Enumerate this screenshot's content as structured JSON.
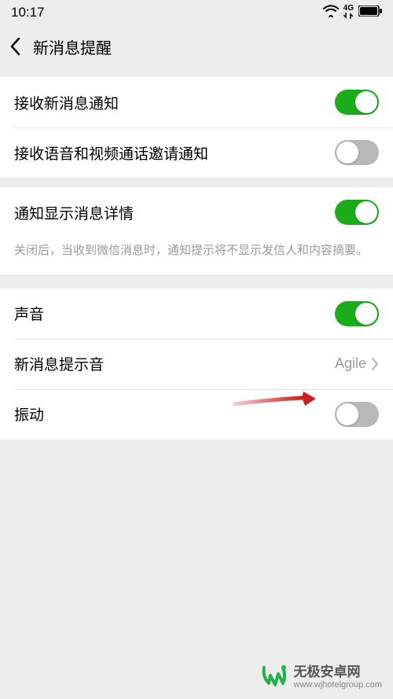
{
  "status_bar": {
    "time": "10:17",
    "network_label": "4G"
  },
  "header": {
    "title": "新消息提醒"
  },
  "groups": {
    "g1": {
      "receive_msg_label": "接收新消息通知",
      "receive_msg_on": true,
      "receive_call_label": "接收语音和视频通话邀请通知",
      "receive_call_on": false
    },
    "g2": {
      "show_detail_label": "通知显示消息详情",
      "show_detail_on": true,
      "show_detail_desc": "关闭后，当收到微信消息时，通知提示将不显示发信人和内容摘要。"
    },
    "g3": {
      "sound_label": "声音",
      "sound_on": true,
      "tone_label": "新消息提示音",
      "tone_value": "Agile",
      "vibrate_label": "振动",
      "vibrate_on": false
    }
  },
  "annotation": {
    "arrow_color": "#cc1f1f"
  },
  "watermark": {
    "brand_cn": "无极安卓网",
    "brand_en": "www.wjhotelgroup.com",
    "accent_color": "#22b14c"
  }
}
